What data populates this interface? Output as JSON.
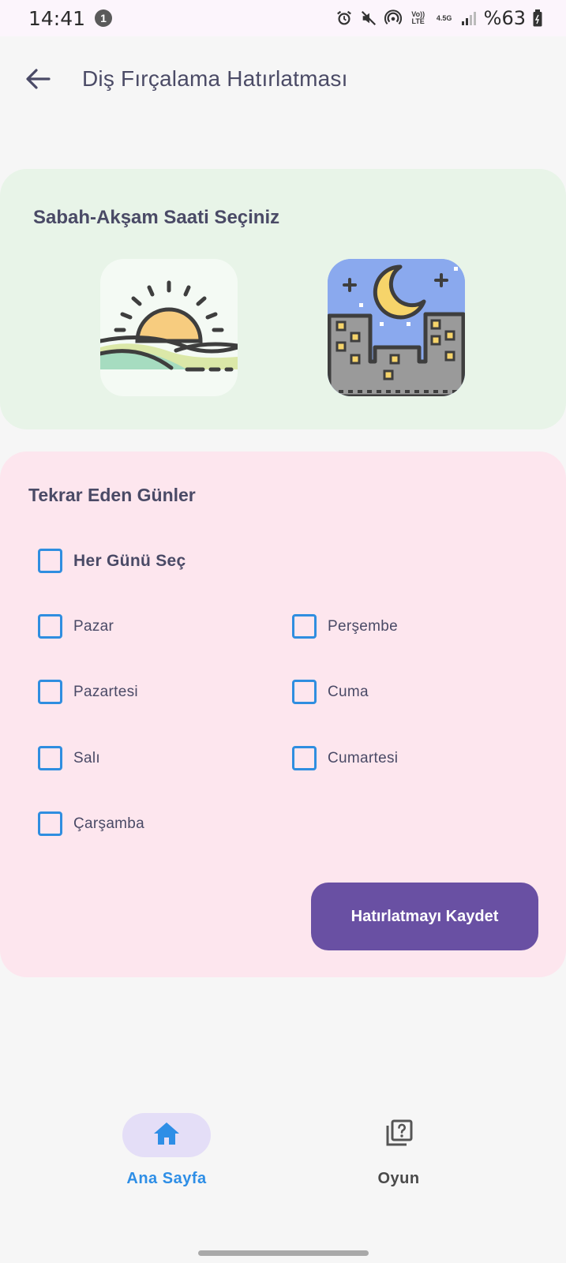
{
  "status_bar": {
    "time": "14:41",
    "notification_count": "1",
    "volte_label": "Vo)) LTE",
    "network_label": "4.5G",
    "battery": "%63"
  },
  "app_bar": {
    "title": "Diş Fırçalama Hatırlatması",
    "back_icon": "arrow-back-icon"
  },
  "time_card": {
    "title": "Sabah-Akşam Saati Seçiniz",
    "options": [
      {
        "id": "morning",
        "icon": "sunrise-icon"
      },
      {
        "id": "evening",
        "icon": "night-city-moon-icon"
      }
    ],
    "background": "#e8f4e8"
  },
  "days_card": {
    "title": "Tekrar Eden Günler",
    "select_all": "Her Günü Seç",
    "days": [
      "Pazar",
      "Pazartesi",
      "Salı",
      "Çarşamba",
      "Perşembe",
      "Cuma",
      "Cumartesi"
    ],
    "checked": [
      false,
      false,
      false,
      false,
      false,
      false,
      false
    ],
    "select_all_checked": false,
    "save_button": "Hatırlatmayı Kaydet",
    "background": "#fde6ee",
    "accent": "#6950a3",
    "checkbox_color": "#2f8ee0"
  },
  "bottom_nav": {
    "items": [
      {
        "label": "Ana Sayfa",
        "icon": "home-icon",
        "active": true
      },
      {
        "label": "Oyun",
        "icon": "quiz-cards-icon",
        "active": false
      }
    ],
    "active_color": "#2e8ee6"
  }
}
